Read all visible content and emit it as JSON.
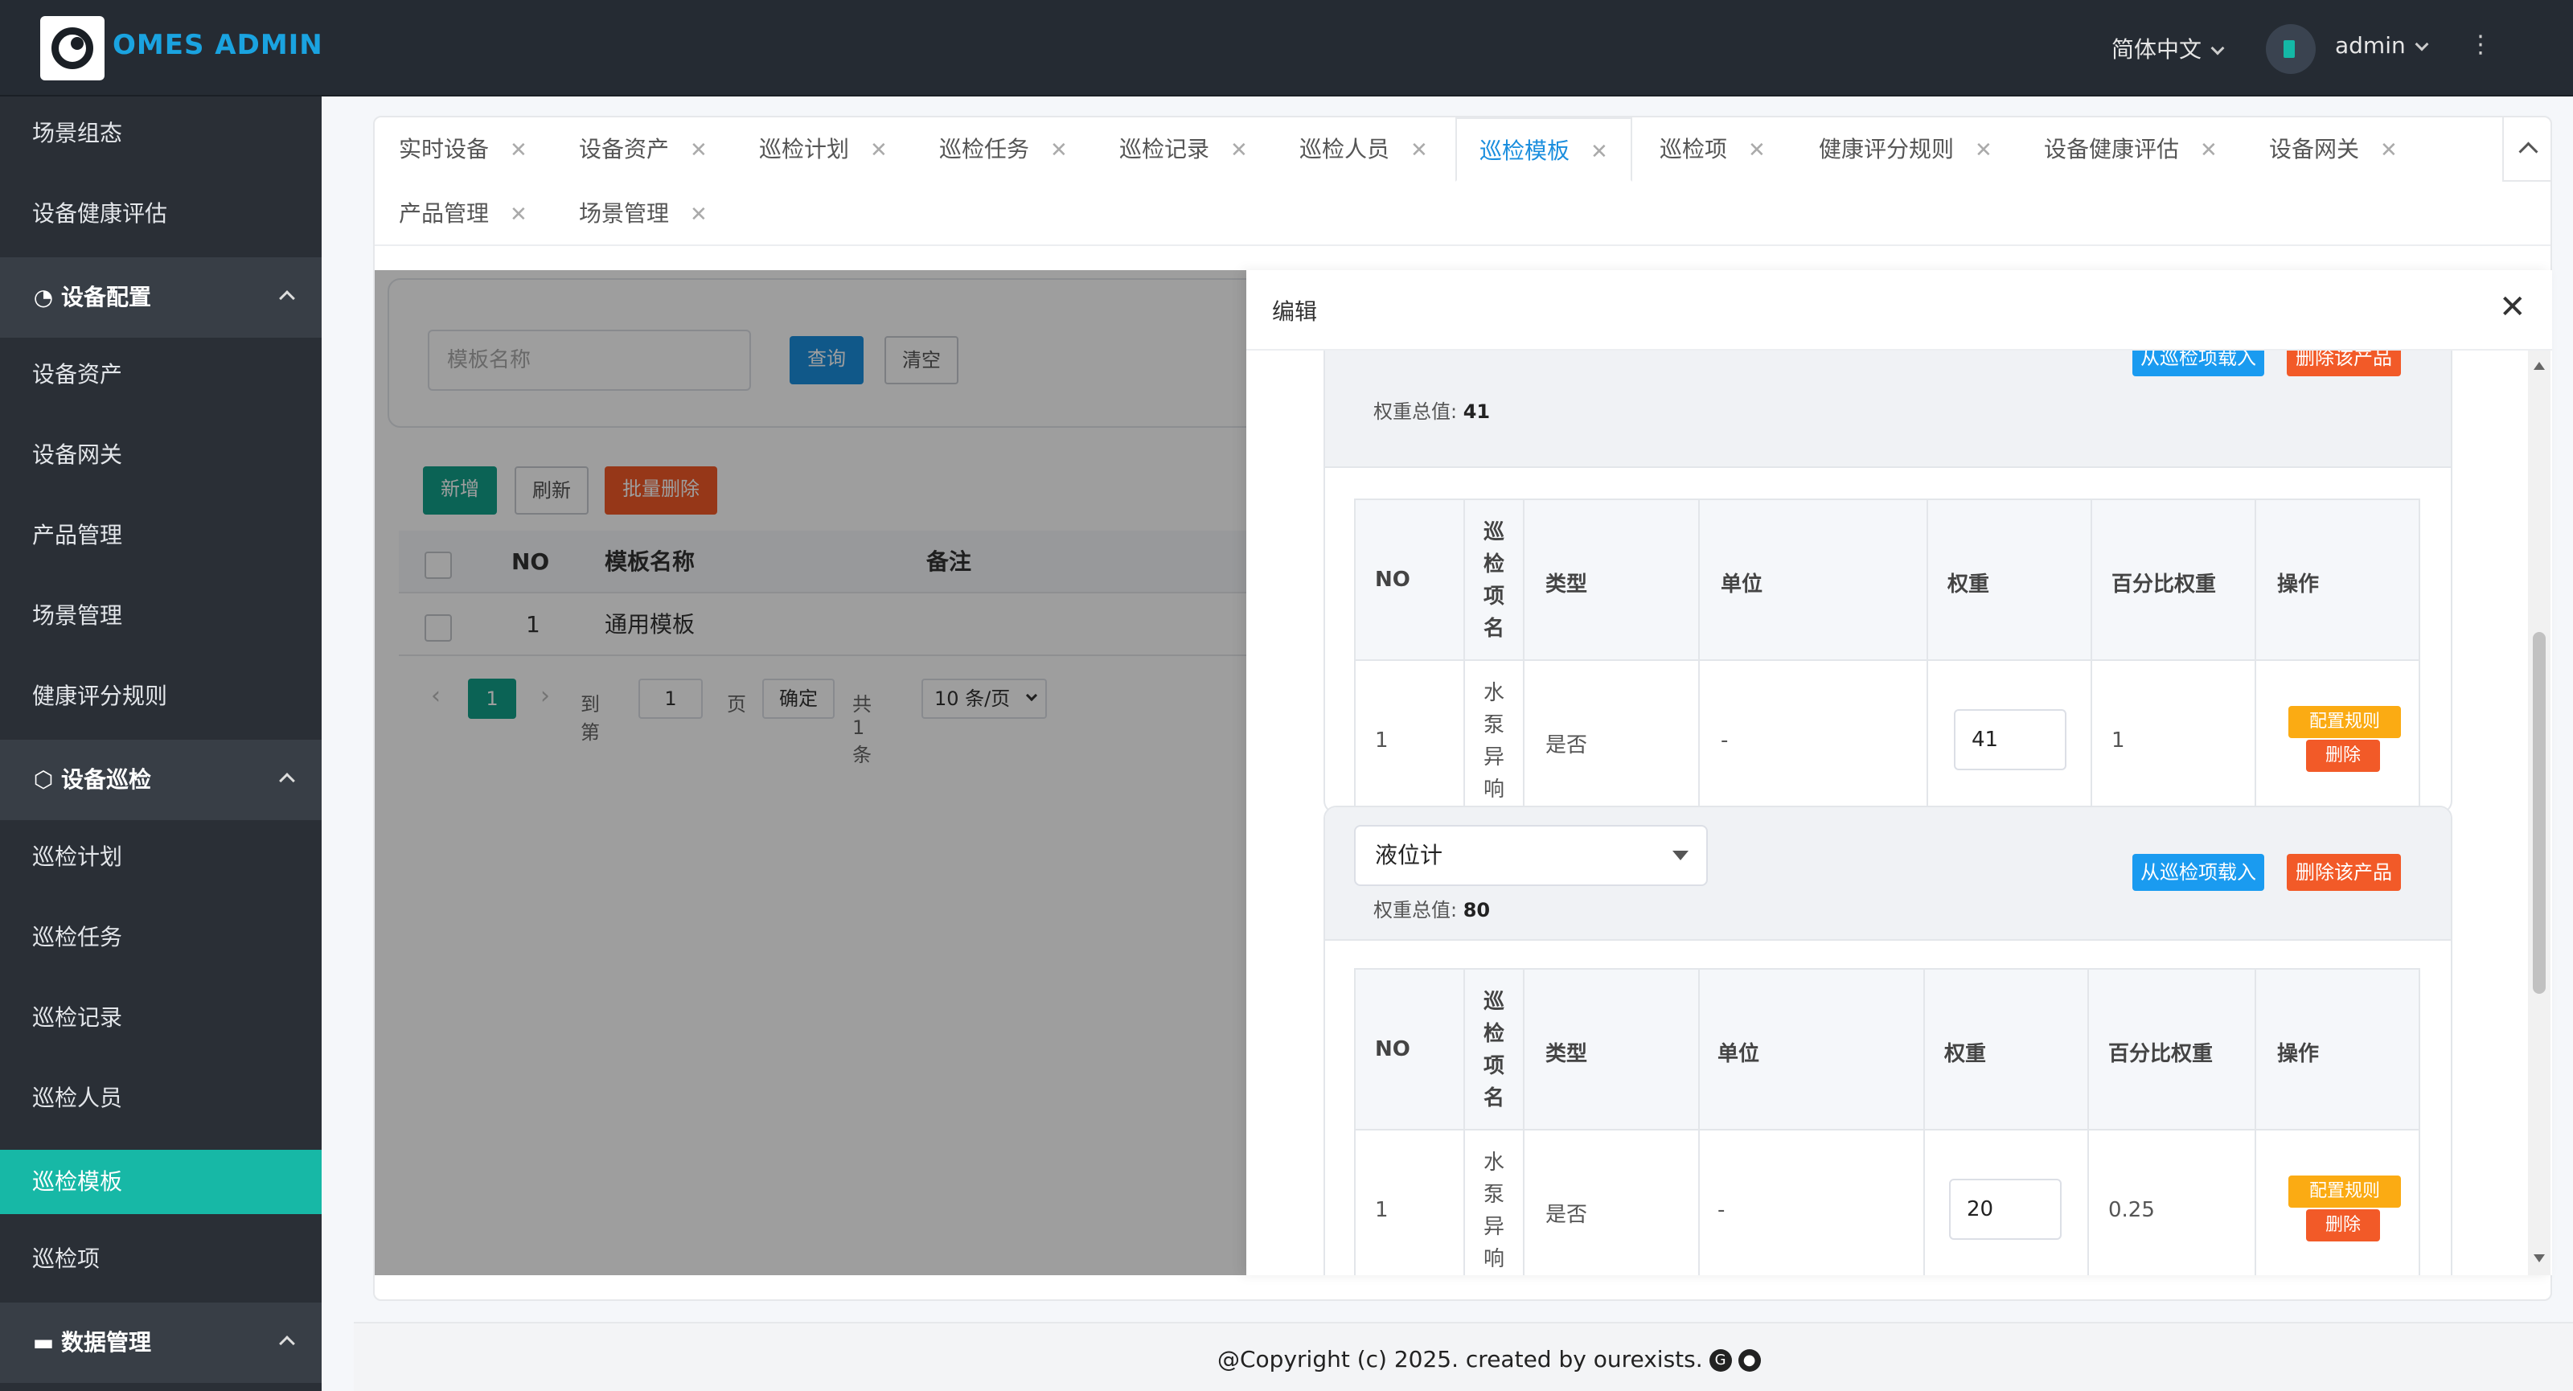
{
  "header": {
    "logo_text": "OMES ADMIN",
    "language": "简体中文",
    "username": "admin"
  },
  "sidebar": {
    "top_items": [
      "场景组态",
      "设备健康评估"
    ],
    "group_config": {
      "label": "设备配置",
      "items": [
        "设备资产",
        "设备网关",
        "产品管理",
        "场景管理",
        "健康评分规则"
      ]
    },
    "group_inspection": {
      "label": "设备巡检",
      "items": [
        "巡检计划",
        "巡检任务",
        "巡检记录",
        "巡检人员",
        "巡检模板",
        "巡检项"
      ],
      "active": "巡检模板"
    },
    "group_data": {
      "label": "数据管理"
    }
  },
  "tabs": {
    "row1": [
      "实时设备",
      "设备资产",
      "巡检计划",
      "巡检任务",
      "巡检记录",
      "巡检人员",
      "巡检模板",
      "巡检项",
      "健康评分规则",
      "设备健康评估",
      "设备网关"
    ],
    "row2": [
      "产品管理",
      "场景管理"
    ],
    "active": "巡检模板",
    "close": "✕"
  },
  "list": {
    "search_placeholder": "模板名称",
    "query_label": "查询",
    "clear_label": "清空",
    "add_label": "新增",
    "refresh_label": "刷新",
    "batch_delete_label": "批量删除",
    "columns": [
      "NO",
      "模板名称",
      "备注"
    ],
    "rows": [
      {
        "no": "1",
        "name": "通用模板",
        "note": ""
      }
    ],
    "pager": {
      "current": "1",
      "goto_label": "到第",
      "page_input": "1",
      "page_suffix": "页",
      "confirm": "确定",
      "total": "共 1 条",
      "size": "10 条/页"
    }
  },
  "drawer": {
    "title": "编辑",
    "top_card": {
      "weight_label": "权重总值:",
      "weight_total": "41"
    },
    "cards": [
      {
        "columns": [
          "NO",
          "巡检项名",
          "类型",
          "单位",
          "权重",
          "百分比权重",
          "操作"
        ],
        "rows": [
          {
            "no": "1",
            "item_name": "水泵异响",
            "type": "是否",
            "unit": "-",
            "weight": "41",
            "percent": "1"
          }
        ]
      },
      {
        "product": "液位计",
        "load_btn": "从巡检项载入",
        "delete_product_btn": "删除该产品",
        "weight_label": "权重总值:",
        "weight_total": "80",
        "columns": [
          "NO",
          "巡检项名",
          "类型",
          "单位",
          "权重",
          "百分比权重",
          "操作"
        ],
        "rows": [
          {
            "no": "1",
            "item_name": "水泵异响",
            "type": "是否",
            "unit": "-",
            "weight": "20",
            "percent": "0.25"
          }
        ]
      }
    ],
    "config_rule_btn": "配置规则",
    "delete_btn": "删除"
  },
  "footer": {
    "text": "@Copyright (c) 2025. created by ourexists."
  }
}
